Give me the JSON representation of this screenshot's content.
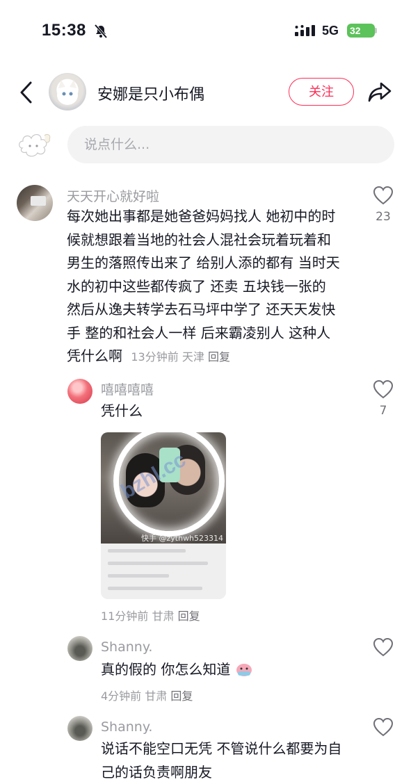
{
  "status_bar": {
    "time": "15:38",
    "network": "5G",
    "battery": "32"
  },
  "header": {
    "account_name": "安娜是只小布偶",
    "follow_label": "关注"
  },
  "comment_input": {
    "placeholder": "说点什么..."
  },
  "comments": [
    {
      "user": "天天开心就好啦",
      "lines": [
        "每次她出事都是她爸爸妈妈找人 她初中的时",
        "候就想跟着当地的社会人混社会玩着玩着和",
        "男生的落照传出来了 给别人添的都有 当时天",
        "水的初中这些都传疯了 还卖 五块钱一张的",
        "然后从逸夫转学去石马坪中学了 还天天发快",
        "手 整的和社会人一样 后来霸凌别人 这种人"
      ],
      "last_line": "凭什么啊",
      "time": "13分钟前",
      "location": "天津",
      "reply_label": "回复",
      "likes": "23"
    },
    {
      "user": "嘻嘻嘻嘻",
      "text": "凭什么",
      "image_watermark": "快手 @zythwh523314",
      "time": "11分钟前",
      "location": "甘肃",
      "reply_label": "回复",
      "likes": "7"
    },
    {
      "user": "Shanny.",
      "text": "真的假的 你怎么知道",
      "time": "4分钟前",
      "location": "甘肃",
      "reply_label": "回复"
    },
    {
      "user": "Shanny.",
      "lines": [
        "说话不能空口无凭 不管说什么都要为自",
        "己的话负责啊朋友"
      ]
    }
  ],
  "overlay_watermark": "bzhl.cc",
  "icons": [
    "mute-bell-icon",
    "signal-icon",
    "back-arrow-icon",
    "share-arrow-icon",
    "heart-icon",
    "emoji-icon"
  ],
  "colors": {
    "accent": "#fe2c55",
    "muted_text": "#9a9ba0",
    "input_bg": "#f3f3f4"
  }
}
